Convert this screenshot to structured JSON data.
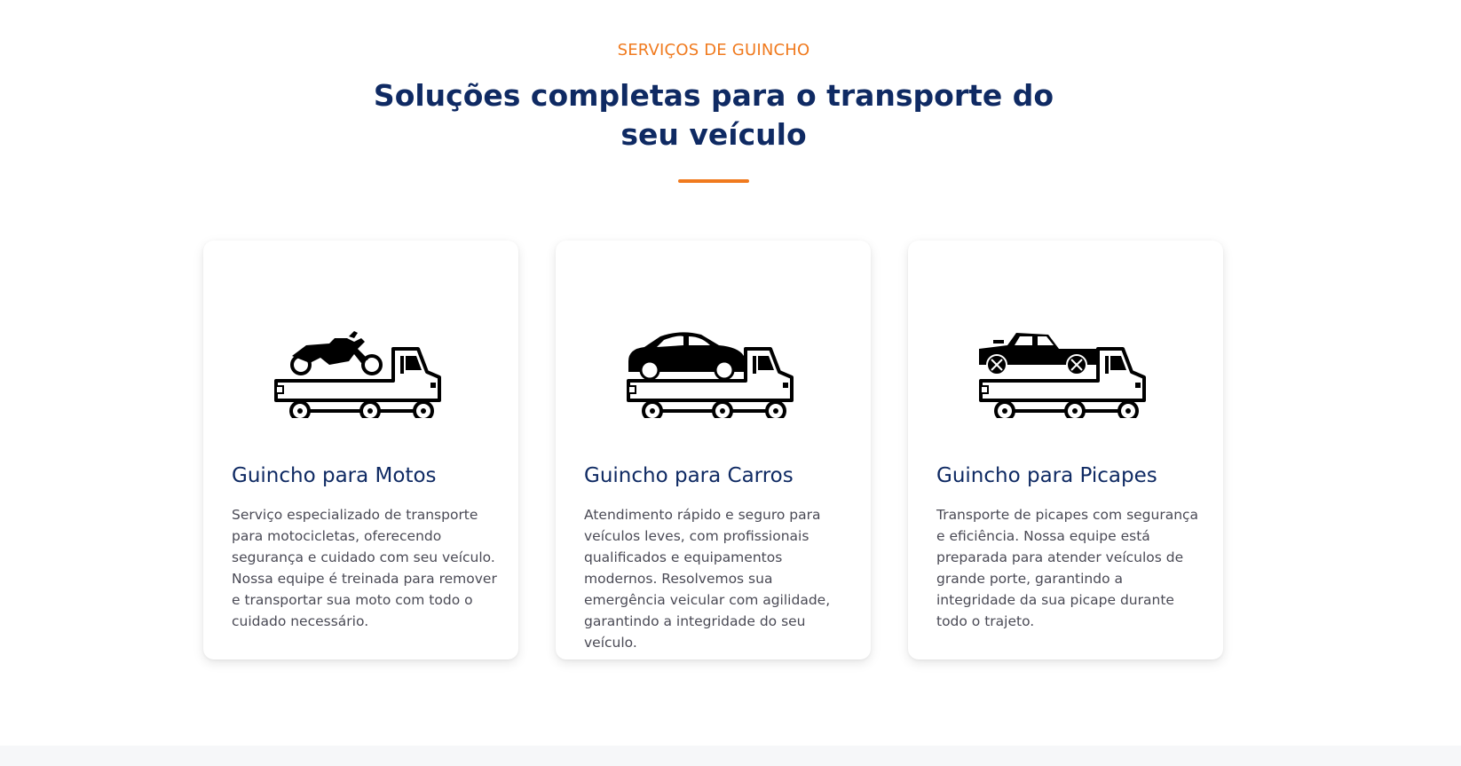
{
  "section": {
    "eyebrow": "SERVIÇOS DE GUINCHO",
    "heading": "Soluções completas para o transporte do seu veículo",
    "accent_color": "#f07a1e",
    "heading_color": "#0f2a63"
  },
  "cards": [
    {
      "icon": "tow-truck-motorcycle-icon",
      "title": "Guincho para Motos",
      "text": "Serviço especializado de transporte para motocicletas, oferecendo segurança e cuidado com seu veículo. Nossa equipe é treinada para remover e transportar sua moto com todo o cuidado necessário."
    },
    {
      "icon": "tow-truck-car-icon",
      "title": "Guincho para Carros",
      "text": "Atendimento rápido e seguro para veículos leves, com profissionais qualificados e equipamentos modernos. Resolvemos sua emergência veicular com agilidade, garantindo a integridade do seu veículo."
    },
    {
      "icon": "tow-truck-pickup-icon",
      "title": "Guincho para Picapes",
      "text": "Transporte de picapes com segurança e eficiência. Nossa equipe está preparada para atender veículos de grande porte, garantindo a integridade da sua picape durante todo o trajeto."
    }
  ]
}
